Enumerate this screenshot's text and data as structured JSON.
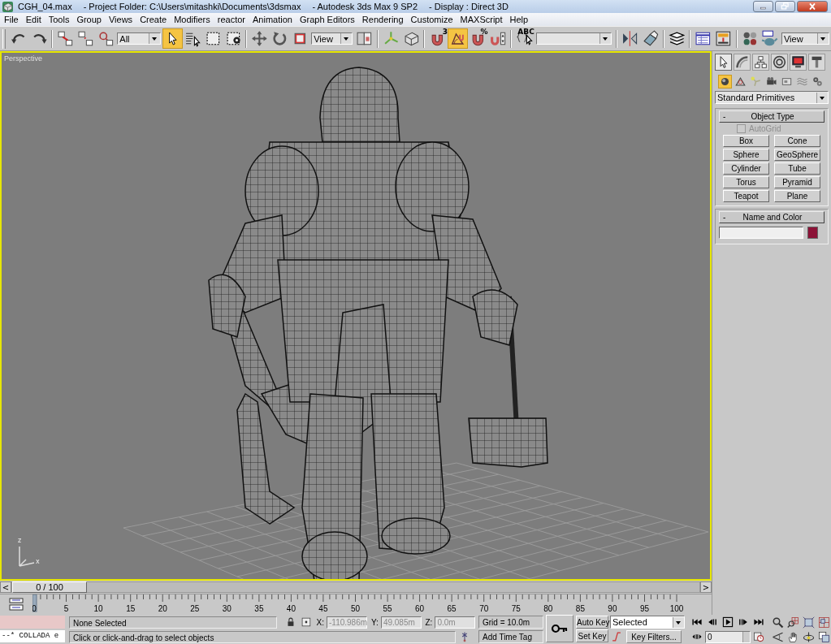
{
  "window": {
    "title_parts": [
      "CGH_04.max",
      "- Project Folder: C:\\Users\\mitashki\\Documents\\3dsmax",
      "- Autodesk 3ds Max 9 SP2",
      "- Display : Direct 3D"
    ]
  },
  "window_controls": [
    {
      "kind": "minimize"
    },
    {
      "kind": "restore"
    },
    {
      "kind": "close"
    }
  ],
  "menu": [
    "File",
    "Edit",
    "Tools",
    "Group",
    "Views",
    "Create",
    "Modifiers",
    "reactor",
    "Animation",
    "Graph Editors",
    "Rendering",
    "Customize",
    "MAXScript",
    "Help"
  ],
  "toolbar": [
    {
      "kind": "icon",
      "selected": false
    },
    {
      "kind": "icon",
      "selected": false
    },
    {
      "kind": "separator"
    },
    {
      "kind": "icon",
      "selected": false
    },
    {
      "kind": "icon",
      "selected": false
    },
    {
      "kind": "icon",
      "selected": false
    },
    {
      "kind": "dropdown",
      "value": "All"
    },
    {
      "kind": "icon",
      "selected": true
    },
    {
      "kind": "icon",
      "selected": false
    },
    {
      "kind": "icon",
      "selected": false
    },
    {
      "kind": "icon",
      "selected": false
    },
    {
      "kind": "separator"
    },
    {
      "kind": "icon",
      "selected": false
    },
    {
      "kind": "icon",
      "selected": false
    },
    {
      "kind": "icon",
      "selected": false
    },
    {
      "kind": "dropdown",
      "value": "View"
    },
    {
      "kind": "icon",
      "selected": false
    },
    {
      "kind": "separator"
    },
    {
      "kind": "icon",
      "selected": false
    },
    {
      "kind": "icon",
      "selected": false
    },
    {
      "kind": "separator"
    },
    {
      "kind": "icon",
      "selected": false,
      "badge": "3"
    },
    {
      "kind": "icon",
      "selected": true
    },
    {
      "kind": "icon",
      "selected": false,
      "badge": "%"
    },
    {
      "kind": "icon",
      "selected": false
    },
    {
      "kind": "separator"
    },
    {
      "kind": "icon",
      "selected": false,
      "badge": "ABC"
    },
    {
      "kind": "dropdown"
    },
    {
      "kind": "separator"
    },
    {
      "kind": "icon",
      "selected": false
    },
    {
      "kind": "icon",
      "selected": false
    },
    {
      "kind": "separator"
    },
    {
      "kind": "icon",
      "selected": false
    },
    {
      "kind": "separator"
    },
    {
      "kind": "icon",
      "selected": false
    },
    {
      "kind": "icon",
      "selected": false
    },
    {
      "kind": "separator"
    },
    {
      "kind": "icon",
      "selected": false
    },
    {
      "kind": "icon",
      "selected": false
    },
    {
      "kind": "dropdown",
      "value": "View"
    }
  ],
  "viewport": {
    "label": "Perspective",
    "active": true,
    "axis_labels": [
      "z",
      "x"
    ]
  },
  "command_panel": {
    "tabs": [
      {
        "selected": true
      },
      {
        "selected": false
      },
      {
        "selected": false
      },
      {
        "selected": false
      },
      {
        "selected": false
      },
      {
        "selected": false
      }
    ],
    "categories": [
      {
        "selected": true
      },
      {
        "selected": false
      },
      {
        "selected": false
      },
      {
        "selected": false
      },
      {
        "selected": false
      },
      {
        "selected": false
      },
      {
        "selected": false
      }
    ],
    "dropdown": "Standard Primitives",
    "rollouts": [
      {
        "kind": "buttons",
        "sign": "-",
        "title": "Object Type",
        "autogrid": {
          "label": "AutoGrid",
          "checked": false,
          "disabled": true
        },
        "buttons": [
          "Box",
          "Cone",
          "Sphere",
          "GeoSphere",
          "Cylinder",
          "Tube",
          "Torus",
          "Pyramid",
          "Teapot",
          "Plane"
        ]
      },
      {
        "kind": "name_color",
        "sign": "-",
        "title": "Name and Color",
        "color": "#8c1237"
      }
    ]
  },
  "time_slider": {
    "prev": "<",
    "label": "0 / 100",
    "next": ">",
    "level": 0
  },
  "track_bar": {
    "labels": [
      "0",
      "5",
      "10",
      "15",
      "20",
      "25",
      "30",
      "35",
      "40",
      "45",
      "50",
      "55",
      "60",
      "65",
      "70",
      "75",
      "80",
      "85",
      "90",
      "95",
      "100"
    ]
  },
  "listener": {
    "output": "--* COLLADA e"
  },
  "status": {
    "selection": "None Selected",
    "coords": [
      {
        "label": "X:",
        "value": "-110.986m",
        "disabled": true
      },
      {
        "label": "Y:",
        "value": "49.085m",
        "disabled": true
      },
      {
        "label": "Z:",
        "value": "0.0m",
        "disabled": true
      }
    ],
    "grid": "Grid = 10.0m",
    "prompt": "Click or click-and-drag to select objects",
    "time_tag": "Add Time Tag"
  },
  "keys": {
    "auto_key": "Auto Key",
    "auto_key_on": false,
    "set_key": "Set Key",
    "selection_set": "Selected",
    "key_filters": "Key Filters..."
  },
  "playback": {
    "frame": "0",
    "playing": false
  }
}
